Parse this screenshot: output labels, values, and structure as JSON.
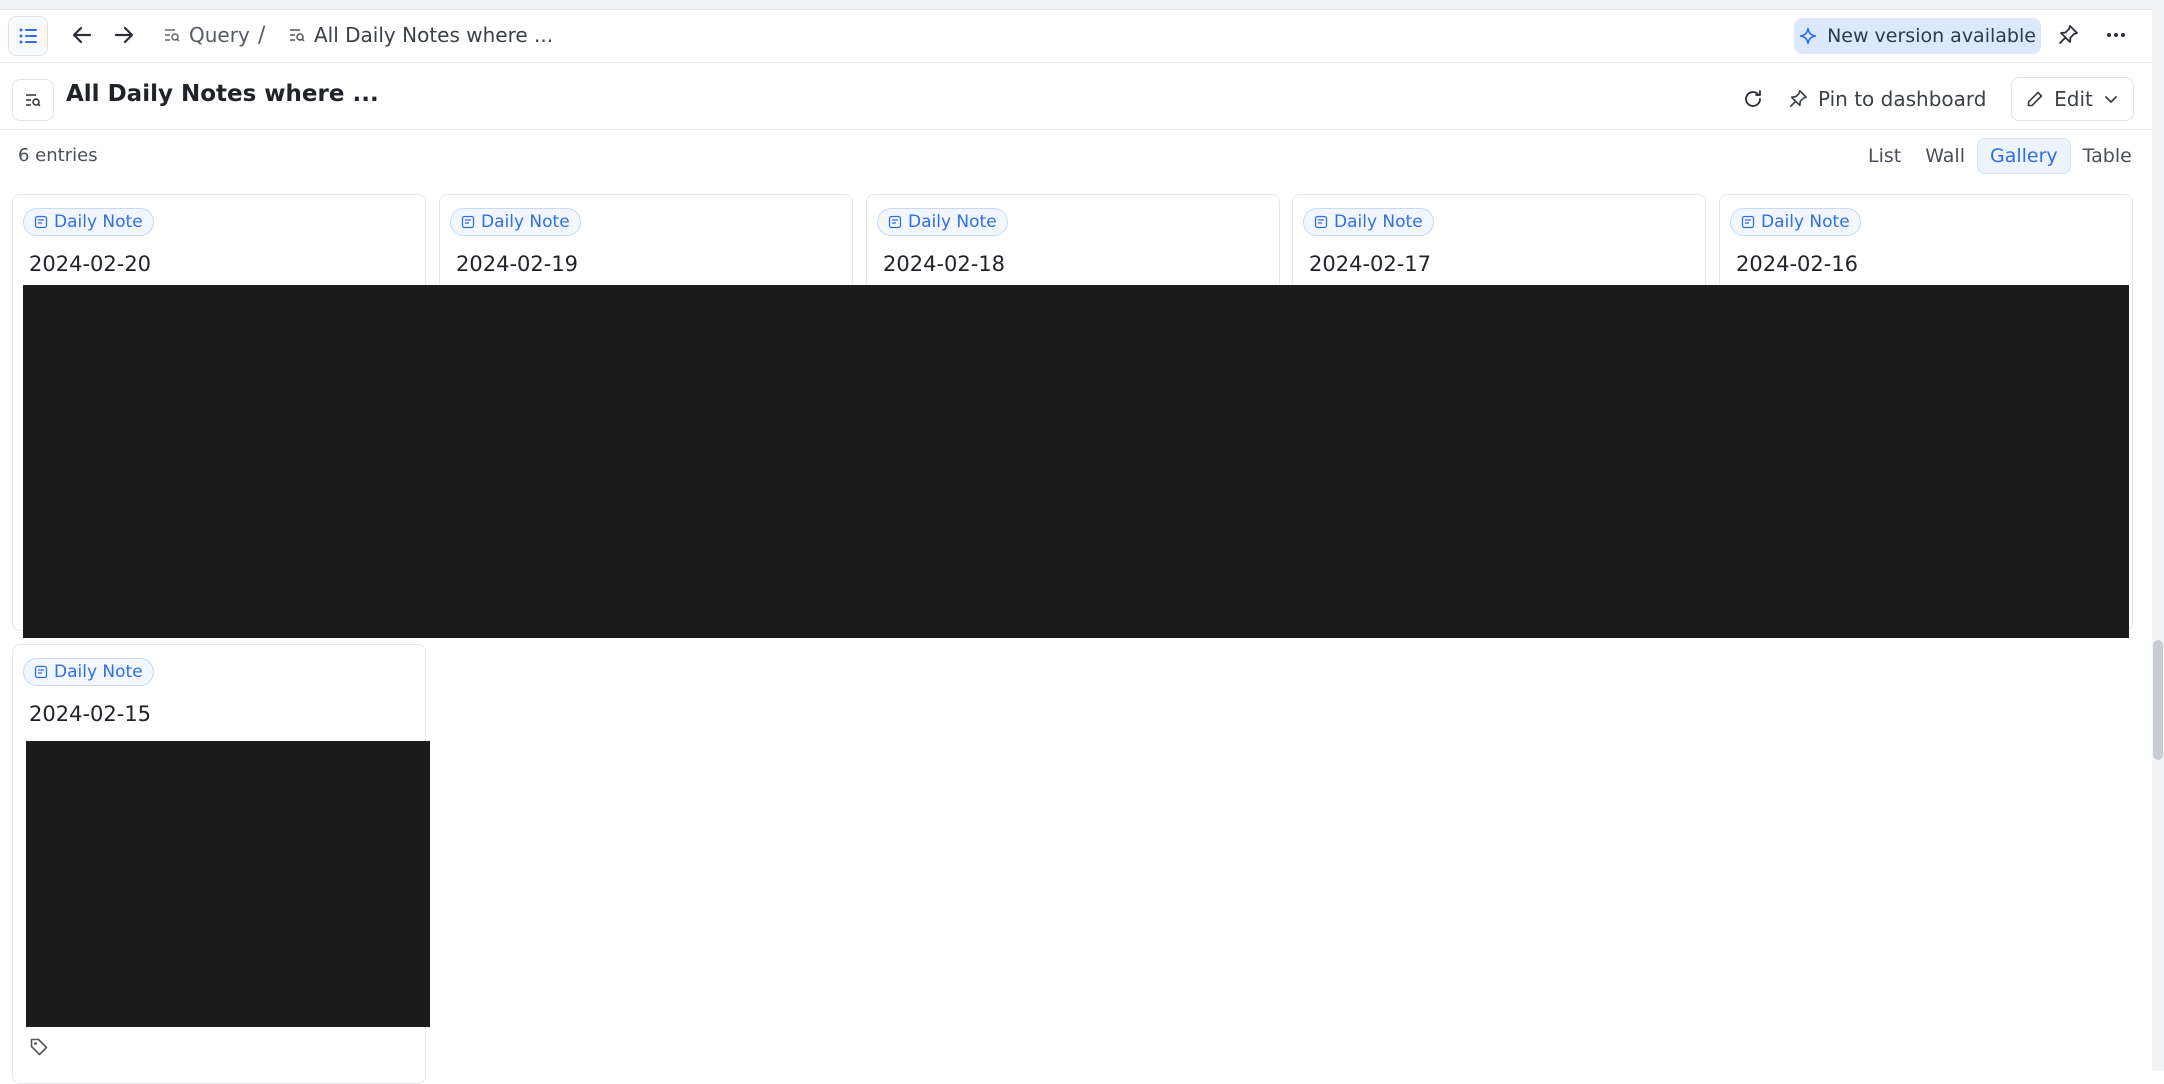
{
  "topbar": {
    "breadcrumb": [
      {
        "label": "Query",
        "icon": "query-list-icon"
      },
      {
        "label": "All Daily Notes where ...",
        "icon": "query-list-icon"
      }
    ],
    "breadcrumb_separator": "/",
    "new_version_label": "New version available"
  },
  "header": {
    "title": "All Daily Notes where ...",
    "pin_label": "Pin to dashboard",
    "edit_label": "Edit"
  },
  "entries_label": "6 entries",
  "view_tabs": [
    {
      "label": "List",
      "active": false
    },
    {
      "label": "Wall",
      "active": false
    },
    {
      "label": "Gallery",
      "active": true
    },
    {
      "label": "Table",
      "active": false
    }
  ],
  "cards": [
    {
      "tag": "Daily Note",
      "title": "2024-02-20"
    },
    {
      "tag": "Daily Note",
      "title": "2024-02-19"
    },
    {
      "tag": "Daily Note",
      "title": "2024-02-18"
    },
    {
      "tag": "Daily Note",
      "title": "2024-02-17"
    },
    {
      "tag": "Daily Note",
      "title": "2024-02-16"
    },
    {
      "tag": "Daily Note",
      "title": "2024-02-15"
    }
  ],
  "colors": {
    "accent": "#2f6fe4",
    "banner_bg": "#dce8fb",
    "redacted": "#1b1b1b"
  }
}
